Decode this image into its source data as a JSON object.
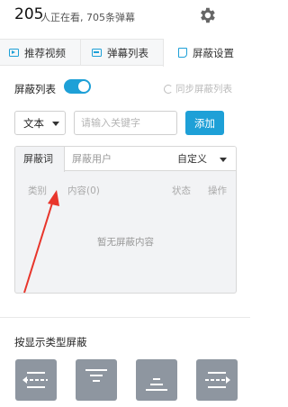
{
  "header": {
    "viewers_count": "205",
    "viewers_text": "人正在看, 705条弹幕",
    "settings_icon": "gear-icon"
  },
  "tabs": [
    {
      "label": "推荐视频",
      "icon": "play-icon"
    },
    {
      "label": "弹幕列表",
      "icon": "danmaku-list-icon"
    },
    {
      "label": "屏蔽设置",
      "icon": "shield-icon",
      "active": true
    }
  ],
  "block_list": {
    "label": "屏蔽列表",
    "enabled": true,
    "sync_label": "同步屏蔽列表"
  },
  "filter": {
    "type_selected": "文本",
    "keyword_placeholder": "请输入关键字",
    "add_label": "添加"
  },
  "panel": {
    "tabs": [
      "屏蔽词",
      "屏蔽用户",
      "自定义"
    ],
    "columns": [
      "类别",
      "内容(0)",
      "状态",
      "操作"
    ],
    "empty_text": "暂无屏蔽内容"
  },
  "type_section": {
    "title": "按显示类型屏蔽",
    "buttons": [
      "scroll-danmaku-icon",
      "top-danmaku-icon",
      "bottom-danmaku-icon",
      "reverse-danmaku-icon"
    ]
  },
  "colors": {
    "accent": "#1ea0d7",
    "annotation_arrow": "#e8352b",
    "type_button": "#8e96a0"
  }
}
